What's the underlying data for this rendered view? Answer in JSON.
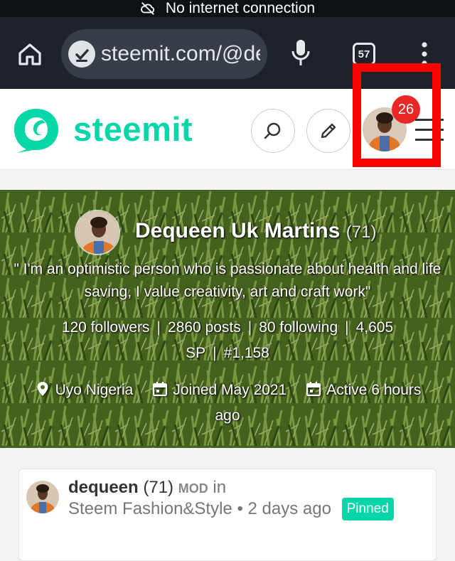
{
  "status_bar": {
    "message": "No internet connection",
    "icon": "no-cloud-icon"
  },
  "browser": {
    "url": "steemit.com/@dequeen",
    "tab_count": "57",
    "icons": [
      "home-icon",
      "site-info-icon",
      "mic-icon",
      "tabs-icon",
      "overflow-menu-icon"
    ]
  },
  "site_header": {
    "brand": "steemit",
    "notification_count": "26",
    "icons": [
      "steemit-logo-icon",
      "search-icon",
      "pencil-icon",
      "avatar",
      "hamburger-icon"
    ],
    "colors": {
      "brand": "#07d6a9",
      "badge": "#ea2626",
      "highlight": "#ff0000"
    }
  },
  "profile": {
    "name": "Dequeen Uk Martins",
    "reputation": "(71)",
    "about": "\" I'm an optimistic person who is passionate about health and life saving, I value creativity, art and craft work\"",
    "stats": {
      "followers": "120 followers",
      "posts": "2860 posts",
      "following": "80 following",
      "sp": "4,605 SP",
      "rank": "#1,158"
    },
    "location": "Uyo Nigeria",
    "joined": "Joined May 2021",
    "active": "Active 6 hours ago",
    "icons": [
      "location-pin-icon",
      "calendar-icon",
      "calendar-icon"
    ]
  },
  "post_card": {
    "author": "dequeen",
    "reputation": "(71)",
    "mod_badge": "MOD",
    "in_label": "in",
    "community": "Steem Fashion&Style",
    "age": "2 days ago",
    "pinned_label": "Pinned"
  }
}
